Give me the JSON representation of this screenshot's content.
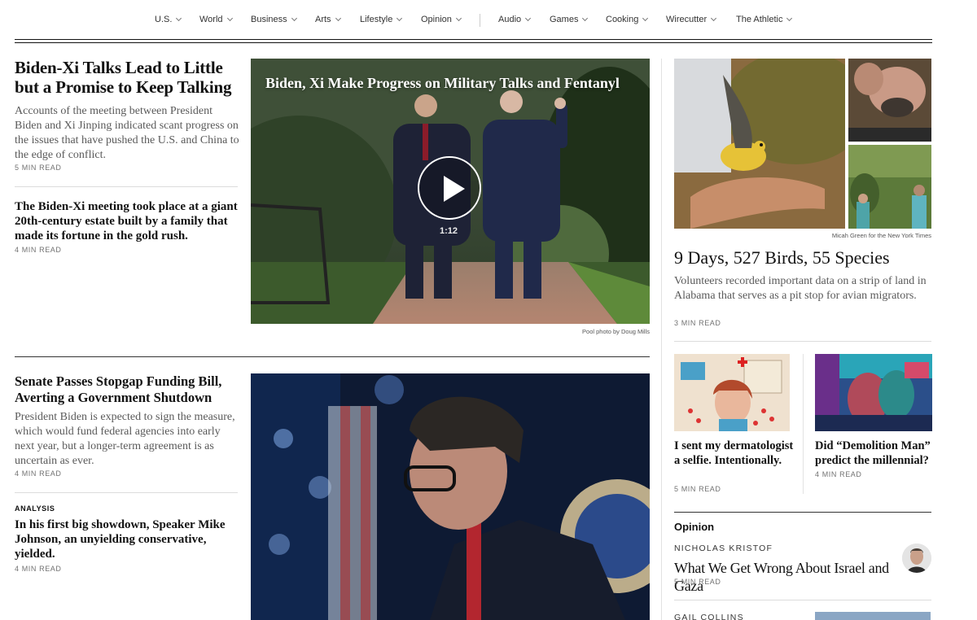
{
  "nav": {
    "items": [
      "U.S.",
      "World",
      "Business",
      "Arts",
      "Lifestyle",
      "Opinion",
      "Audio",
      "Games",
      "Cooking",
      "Wirecutter",
      "The Athletic"
    ]
  },
  "lead": {
    "headline": "Biden-Xi Talks Lead to Little but a Promise to Keep Talking",
    "summary": "Accounts of the meeting between President Biden and Xi Jinping indicated scant progress on the issues that have pushed the U.S. and China to the edge of conflict.",
    "readtime": "5 MIN READ",
    "sub_headline": "The Biden-Xi meeting took place at a giant 20th-century estate built by a family that made its fortune in the gold rush.",
    "sub_readtime": "4 MIN READ"
  },
  "video": {
    "title": "Biden, Xi Make Progress on Military Talks and Fentanyl",
    "duration": "1:12",
    "credit": "Pool photo by Doug Mills"
  },
  "senate": {
    "headline": "Senate Passes Stopgap Funding Bill, Averting a Government Shutdown",
    "summary": "President Biden is expected to sign the measure, which would fund federal agencies into early next year, but a longer-term agreement is as uncertain as ever.",
    "readtime": "4 MIN READ",
    "kicker": "ANALYSIS",
    "analysis_headline": "In his first big showdown, Speaker Mike Johnson, an unyielding conservative, yielded.",
    "analysis_readtime": "4 MIN READ"
  },
  "birds": {
    "credit": "Micah Green for the New York Times",
    "headline": "9 Days, 527 Birds, 55 Species",
    "summary": "Volunteers recorded important data on a strip of land in Alabama that serves as a pit stop for avian migrators.",
    "readtime": "3 MIN READ"
  },
  "cards": [
    {
      "headline": "I sent my dermatologist a selfie. Intentionally.",
      "readtime": "5 MIN READ"
    },
    {
      "headline": "Did “Demolition Man” predict the millennial?",
      "readtime": "4 MIN READ"
    }
  ],
  "opinion": {
    "label": "Opinion",
    "author1": "NICHOLAS KRISTOF",
    "headline1": "What We Get Wrong About Israel and Gaza",
    "readtime1": "5 MIN READ",
    "author2": "GAIL COLLINS"
  }
}
